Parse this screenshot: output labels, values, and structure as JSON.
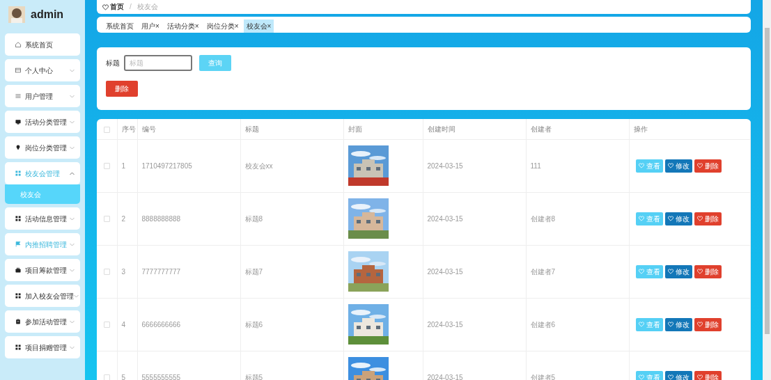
{
  "user": {
    "name": "admin"
  },
  "menu": [
    {
      "label": "系统首页",
      "highlighted": false
    },
    {
      "label": "个人中心",
      "expanded": false,
      "highlighted": false
    },
    {
      "label": "用户管理",
      "expanded": false,
      "highlighted": false
    },
    {
      "label": "活动分类管理",
      "expanded": false,
      "highlighted": false
    },
    {
      "label": "岗位分类管理",
      "expanded": false,
      "highlighted": false
    },
    {
      "label": "校友会管理",
      "expanded": true,
      "highlighted": true,
      "children": [
        {
          "label": "校友会",
          "selected": true
        }
      ]
    },
    {
      "label": "活动信息管理",
      "expanded": false,
      "highlighted": false
    },
    {
      "label": "内推招聘管理",
      "expanded": false,
      "highlighted": true
    },
    {
      "label": "项目筹款管理",
      "expanded": false,
      "highlighted": false
    },
    {
      "label": "加入校友会管理",
      "expanded": false,
      "highlighted": false
    },
    {
      "label": "参加活动管理",
      "expanded": false,
      "highlighted": false
    },
    {
      "label": "项目捐赠管理",
      "expanded": false,
      "highlighted": false
    }
  ],
  "breadcrumb": {
    "items": [
      "首页",
      "校友会"
    ],
    "separator": "/"
  },
  "tabs": [
    {
      "label": "系统首页",
      "selected": false
    },
    {
      "label": "用户×",
      "selected": false
    },
    {
      "label": "活动分类×",
      "selected": false
    },
    {
      "label": "岗位分类×",
      "selected": false
    },
    {
      "label": "校友会×",
      "selected": true
    }
  ],
  "search": {
    "label": "标题",
    "placeholder": "标题",
    "button": "查询"
  },
  "delete_button": "删除",
  "table": {
    "all_checked": false,
    "columns": [
      "序号",
      "编号",
      "标题",
      "封面",
      "创建时间",
      "创建者",
      "操作"
    ],
    "rows": [
      {
        "index": "1",
        "code": "1710497217805",
        "title": "校友会xx",
        "created": "2024-03-15",
        "creator": "111",
        "checked": false,
        "actions": [
          {
            "label": "查看",
            "kind": "view"
          },
          {
            "label": "修改",
            "kind": "edit"
          },
          {
            "label": "删除",
            "kind": "delete"
          }
        ]
      },
      {
        "index": "2",
        "code": "8888888888",
        "title": "标题8",
        "created": "2024-03-15",
        "creator": "创建者8",
        "checked": false,
        "actions": [
          {
            "label": "查看",
            "kind": "view"
          },
          {
            "label": "修改",
            "kind": "edit"
          },
          {
            "label": "删除",
            "kind": "delete"
          }
        ]
      },
      {
        "index": "3",
        "code": "7777777777",
        "title": "标题7",
        "created": "2024-03-15",
        "creator": "创建者7",
        "checked": false,
        "actions": [
          {
            "label": "查看",
            "kind": "view"
          },
          {
            "label": "修改",
            "kind": "edit"
          },
          {
            "label": "删除",
            "kind": "delete"
          }
        ]
      },
      {
        "index": "4",
        "code": "6666666666",
        "title": "标题6",
        "created": "2024-03-15",
        "creator": "创建者6",
        "checked": false,
        "actions": [
          {
            "label": "查看",
            "kind": "view"
          },
          {
            "label": "修改",
            "kind": "edit"
          },
          {
            "label": "删除",
            "kind": "delete"
          }
        ]
      },
      {
        "index": "5",
        "code": "5555555555",
        "title": "标题5",
        "created": "2024-03-15",
        "creator": "创建者5",
        "checked": false,
        "actions": [
          {
            "label": "查看",
            "kind": "view"
          },
          {
            "label": "修改",
            "kind": "edit"
          },
          {
            "label": "删除",
            "kind": "delete"
          }
        ]
      }
    ]
  }
}
